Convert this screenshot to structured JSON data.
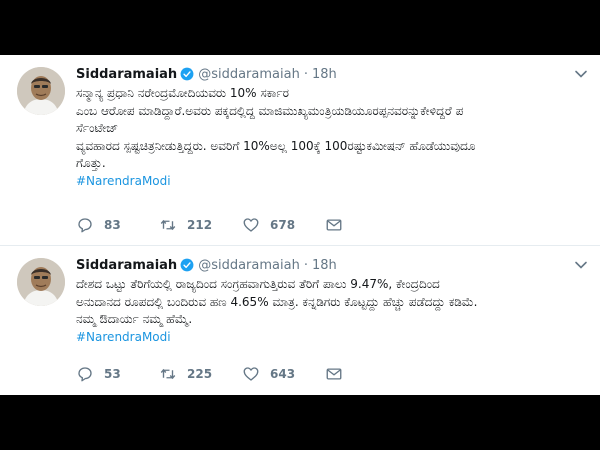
{
  "tweets": [
    {
      "name": "Siddaramaiah",
      "handle": "@siddaramaiah",
      "separator": "·",
      "time": "18h",
      "lines": [
        "ಸನ್ಮಾನ್ಯ ಪ್ರಧಾನಿ ನರೇಂದ್ರಮೋದಿಯವರು  10% ಸರ್ಕಾರ",
        "ಎಂಬ ಆರೋಪ ಮಾಡಿದ್ದಾರೆ.ಅವರು ಪಕ್ಕದಲ್ಲಿದ್ದ ಮಾಜಿಮುಖ್ಯಮಂತ್ರಿಯಡಿಯೂರಪ್ಪನವರನ್ನುಕೇಳಿದ್ದರೆ ಪ",
        "ರ್ಸೆಂಟೇಜ್",
        "ವ್ಯವಹಾರದ ಸ್ಪಷ್ಟಚಿತ್ರನೀಡುತ್ತಿದ್ದರು. ಅವರಿಗೆ 10%ಅಲ್ಲ 100ಕ್ಕೆ 100ರಷ್ಟುಕಮೀಷನ್ ಹೊಡೆಯುವುದೂ",
        "ಗೊತ್ತು."
      ],
      "hashtag": "#NarendraModi",
      "replies": "83",
      "retweets": "212",
      "likes": "678"
    },
    {
      "name": "Siddaramaiah",
      "handle": "@siddaramaiah",
      "separator": "·",
      "time": "18h",
      "lines": [
        "ದೇಶದ ಒಟ್ಟು ತೆರಿಗೆಯಲ್ಲಿ ರಾಜ್ಯದಿಂದ ಸಂಗ್ರಹವಾಗುತ್ತಿರುವ ತೆರಿಗೆ ಪಾಲು 9.47%, ಕೇಂದ್ರದಿಂದ",
        "ಅನುದಾನದ ರೂಪದಲ್ಲಿ ಬಂದಿರುವ ಹಣ 4.65% ಮಾತ್ರ. ಕನ್ನಡಿಗರು ಕೊಟ್ಟದ್ದು ಹೆಚ್ಚು ಪಡೆದದ್ದು ಕಡಿಮೆ.",
        "ನಮ್ಮ ಔದಾರ್ಯ ನಮ್ಮ ಹೆಮ್ಮೆ."
      ],
      "hashtag": "#NarendraModi",
      "replies": "53",
      "retweets": "225",
      "likes": "643"
    }
  ],
  "icons": {
    "verified": "verified-badge-icon",
    "chevron": "chevron-down-icon",
    "reply": "reply-icon",
    "retweet": "retweet-icon",
    "like": "heart-icon"
  },
  "colors": {
    "background": "#000000",
    "card": "#ffffff",
    "link": "#1b95e0",
    "verified": "#1da1f2",
    "muted": "#657786",
    "text": "#14171a"
  }
}
